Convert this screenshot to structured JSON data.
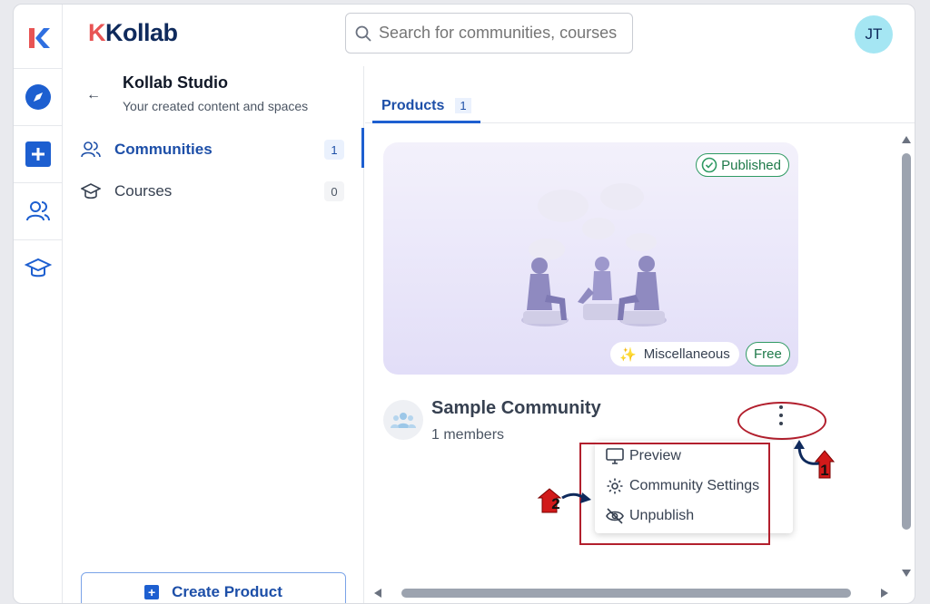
{
  "header": {
    "brand": "Kollab",
    "search_placeholder": "Search for communities, courses",
    "avatar_initials": "JT"
  },
  "sidebar": {
    "title": "Kollab Studio",
    "subtitle": "Your created content and spaces",
    "items": [
      {
        "label": "Communities",
        "count": "1"
      },
      {
        "label": "Courses",
        "count": "0"
      }
    ],
    "create_label": "Create Product"
  },
  "main": {
    "tab_label": "Products",
    "tab_count": "1",
    "card": {
      "status": "Published",
      "category": "Miscellaneous",
      "price": "Free",
      "name": "Sample Community",
      "members": "1 members"
    },
    "menu": [
      {
        "label": "Preview",
        "icon": "monitor-icon"
      },
      {
        "label": "Community Settings",
        "icon": "gear-icon"
      },
      {
        "label": "Unpublish",
        "icon": "eye-off-icon"
      }
    ]
  },
  "annotations": {
    "step1": "1",
    "step2": "2",
    "color": "#b21f2d"
  },
  "colors": {
    "accent": "#1d5fd0",
    "success": "#2f9a63"
  }
}
